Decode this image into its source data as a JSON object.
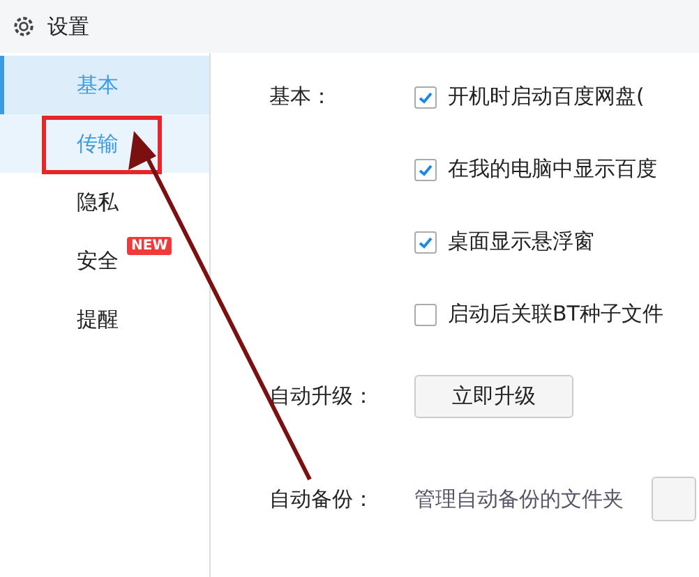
{
  "window": {
    "title": "设置"
  },
  "sidebar": {
    "items": [
      {
        "label": "基本",
        "selected": true,
        "highlighted": false
      },
      {
        "label": "传输",
        "selected": false,
        "highlighted": true
      },
      {
        "label": "隐私",
        "selected": false,
        "highlighted": false
      },
      {
        "label": "安全",
        "selected": false,
        "highlighted": false,
        "badge": "NEW"
      },
      {
        "label": "提醒",
        "selected": false,
        "highlighted": false
      }
    ]
  },
  "sections": [
    {
      "label": "基本：",
      "kind": "checkboxes",
      "options": [
        {
          "text": "开机时启动百度网盘(",
          "checked": true
        },
        {
          "text": "在我的电脑中显示百度",
          "checked": true
        },
        {
          "text": "桌面显示悬浮窗",
          "checked": true
        },
        {
          "text": "启动后关联BT种子文件",
          "checked": false
        }
      ]
    },
    {
      "label": "自动升级：",
      "kind": "button",
      "button": "立即升级"
    },
    {
      "label": "自动备份：",
      "kind": "text",
      "text": "管理自动备份的文件夹"
    }
  ]
}
